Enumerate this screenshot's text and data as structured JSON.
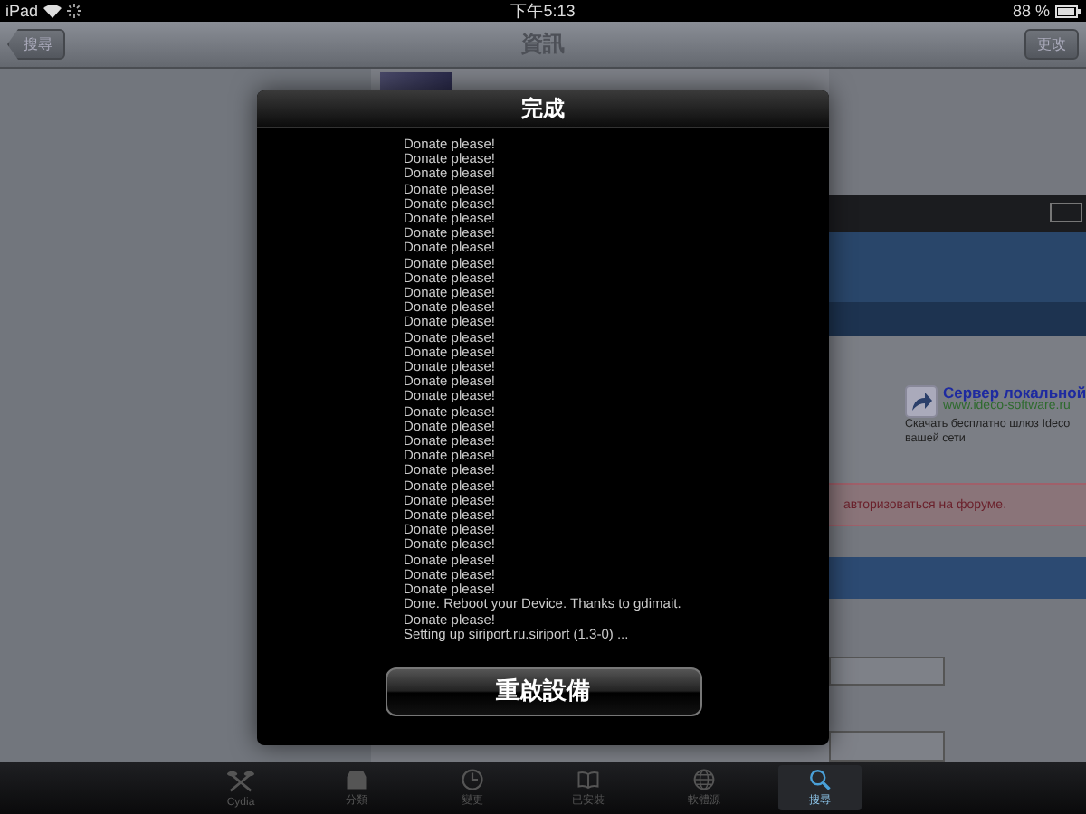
{
  "status_bar": {
    "device": "iPad",
    "time": "下午5:13",
    "battery": "88 %"
  },
  "nav_bar": {
    "back_button": "搜尋",
    "title": "資訊",
    "right_button": "更改"
  },
  "background_page": {
    "ad_title": "Сервер локальной",
    "ad_url": "www.ideco-software.ru",
    "ad_text": "Скачать бесплатно шлюз Ideco вашей сети",
    "notice": "авторизоваться на форуме."
  },
  "dialog": {
    "title": "完成",
    "log": [
      "Donate please!",
      "Donate please!",
      "Donate please!",
      "Donate please!",
      "Donate please!",
      "Donate please!",
      "Donate please!",
      "Donate please!",
      "Donate please!",
      "Donate please!",
      "Donate please!",
      "Donate please!",
      "Donate please!",
      "Donate please!",
      "Donate please!",
      "Donate please!",
      "Donate please!",
      "Donate please!",
      "Donate please!",
      "Donate please!",
      "Donate please!",
      "Donate please!",
      "Donate please!",
      "Donate please!",
      "Donate please!",
      "Donate please!",
      "Donate please!",
      "Donate please!",
      "Donate please!",
      "Donate please!",
      "Donate please!",
      "Done. Reboot your Device. Thanks to gdimait.",
      "Donate please!",
      "Setting up siriport.ru.siriport (1.3-0) ..."
    ],
    "button": "重啟設備"
  },
  "tab_bar": [
    {
      "label": "Cydia",
      "kind": "cydia",
      "selected": false
    },
    {
      "label": "分類",
      "kind": "box",
      "selected": false
    },
    {
      "label": "變更",
      "kind": "clock",
      "selected": false
    },
    {
      "label": "已安裝",
      "kind": "book",
      "selected": false
    },
    {
      "label": "軟體源",
      "kind": "globe",
      "selected": false
    },
    {
      "label": "搜尋",
      "kind": "search",
      "selected": true
    }
  ]
}
